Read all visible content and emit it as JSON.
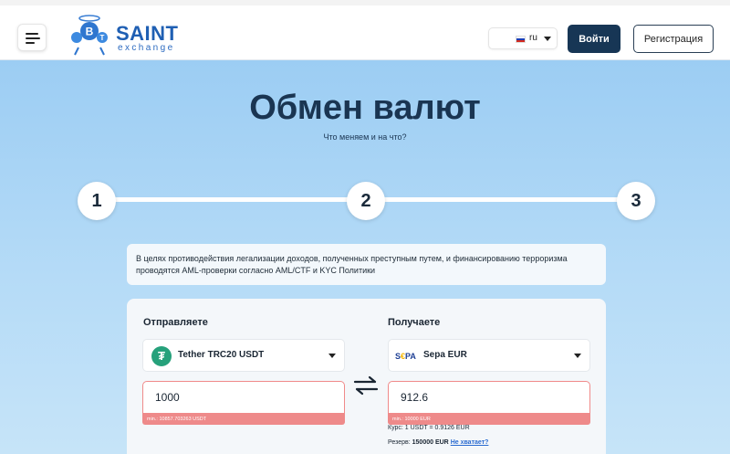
{
  "header": {
    "logo": {
      "name": "SAINT",
      "sub": "exchange"
    },
    "language": {
      "code": "ru"
    },
    "login_label": "Войти",
    "register_label": "Регистрация"
  },
  "hero": {
    "title": "Обмен валют",
    "subtitle": "Что меняем и на что?"
  },
  "steps": [
    "1",
    "2",
    "3"
  ],
  "notice": "В целях противодействия легализации доходов, полученных преступным путем, и финансированию терроризма проводятся AML-проверки согласно AML/CTF и KYC Политики",
  "exchange": {
    "send": {
      "label": "Отправляете",
      "currency": "Tether TRC20 USDT",
      "amount": "1000",
      "error": "min.: 10857.703263 USDT"
    },
    "receive": {
      "label": "Получаете",
      "currency": "Sepa EUR",
      "amount": "912.6",
      "error": "min.: 10000 EUR",
      "rate": "Курс: 1 USDT = 0.9126 EUR",
      "reserve_prefix": "Резерв:",
      "reserve_value": "150000 EUR",
      "reserve_link": "Не хватает?"
    }
  },
  "colors": {
    "accent_dark": "#173655",
    "error": "#ee8a8a",
    "usdt": "#26a17b",
    "logo_blue": "#1f5fb3"
  },
  "icons": {
    "menu": "menu-icon",
    "flag": "russia-flag-icon",
    "swap": "swap-arrows-icon",
    "usdt": "tether-icon",
    "sepa": "sepa-icon"
  }
}
